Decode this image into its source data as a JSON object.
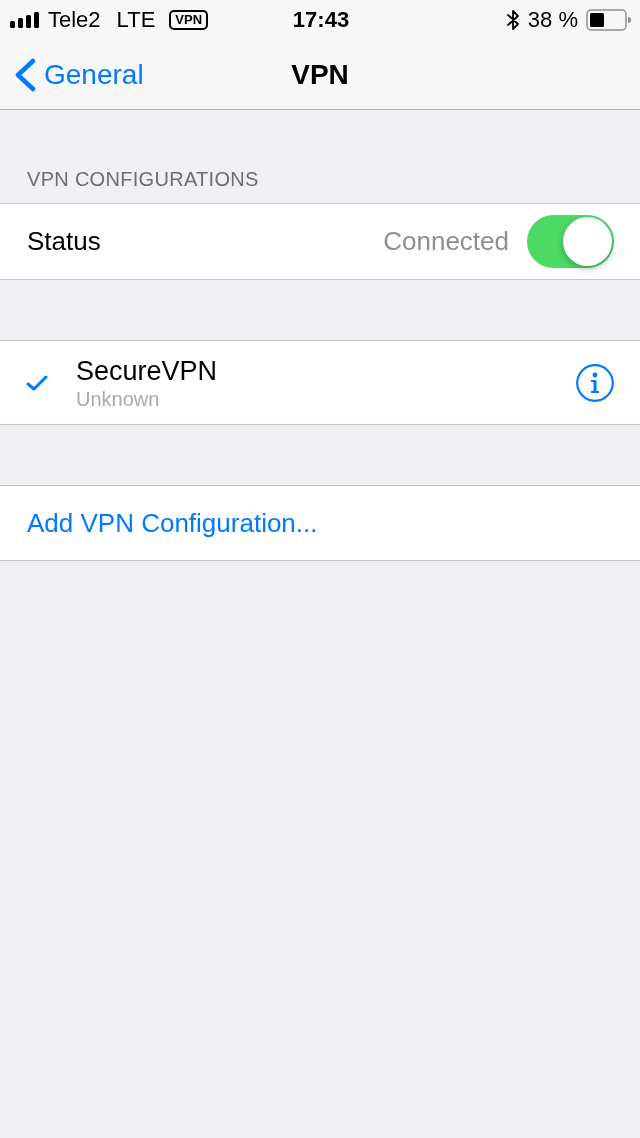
{
  "status_bar": {
    "carrier": "Tele2",
    "network": "LTE",
    "vpn_badge": "VPN",
    "time": "17:43",
    "battery": "38 %"
  },
  "nav": {
    "back": "General",
    "title": "VPN"
  },
  "section_header": "VPN CONFIGURATIONS",
  "status_row": {
    "label": "Status",
    "value": "Connected",
    "on": true
  },
  "configurations": [
    {
      "name": "SecureVPN",
      "detail": "Unknown",
      "selected": true
    }
  ],
  "add_button": "Add VPN Configuration..."
}
